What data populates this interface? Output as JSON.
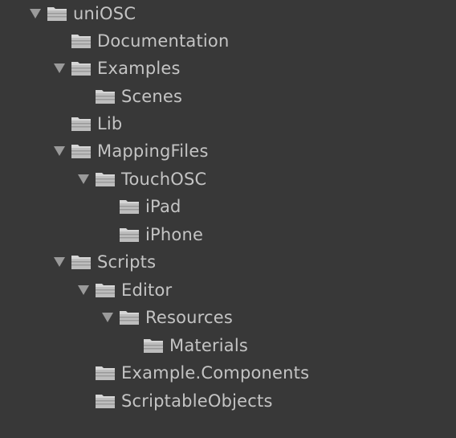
{
  "project_tree": {
    "items": [
      {
        "label": "uniOSC",
        "icon": "folder-icon",
        "expanded": true,
        "has_children": true
      },
      {
        "label": "Documentation",
        "icon": "folder-icon",
        "expanded": false,
        "has_children": false
      },
      {
        "label": "Examples",
        "icon": "folder-icon",
        "expanded": true,
        "has_children": true
      },
      {
        "label": "Scenes",
        "icon": "folder-icon",
        "expanded": false,
        "has_children": false
      },
      {
        "label": "Lib",
        "icon": "folder-icon",
        "expanded": false,
        "has_children": false
      },
      {
        "label": "MappingFiles",
        "icon": "folder-icon",
        "expanded": true,
        "has_children": true
      },
      {
        "label": "TouchOSC",
        "icon": "folder-icon",
        "expanded": true,
        "has_children": true
      },
      {
        "label": "iPad",
        "icon": "folder-icon",
        "expanded": false,
        "has_children": false
      },
      {
        "label": "iPhone",
        "icon": "folder-icon",
        "expanded": false,
        "has_children": false
      },
      {
        "label": "Scripts",
        "icon": "folder-icon",
        "expanded": true,
        "has_children": true
      },
      {
        "label": "Editor",
        "icon": "folder-icon",
        "expanded": true,
        "has_children": true
      },
      {
        "label": "Resources",
        "icon": "folder-icon",
        "expanded": true,
        "has_children": true
      },
      {
        "label": "Materials",
        "icon": "folder-icon",
        "expanded": false,
        "has_children": false
      },
      {
        "label": "Example.Components",
        "icon": "folder-icon",
        "expanded": false,
        "has_children": false
      },
      {
        "label": "ScriptableObjects",
        "icon": "folder-icon",
        "expanded": false,
        "has_children": false
      }
    ]
  },
  "colors": {
    "background": "#383838",
    "text": "#c4c4c4",
    "arrow": "#9a9a9a",
    "folder": "#bdbdbd"
  }
}
